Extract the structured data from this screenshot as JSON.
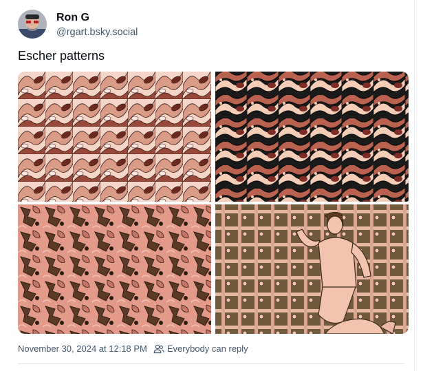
{
  "author": {
    "display_name": "Ron G",
    "handle": "@rgart.bsky.social"
  },
  "post": {
    "text": "Escher patterns",
    "timestamp": "November 30, 2024 at 12:18 PM",
    "reply_setting": "Everybody can reply",
    "reply_icon": "people-icon"
  },
  "images": [
    {
      "name": "pattern-pink-brown-swirl",
      "palette": [
        "#f3d6c8",
        "#d99a86",
        "#9a4a3c",
        "#6e2a22"
      ]
    },
    {
      "name": "pattern-stripes-black",
      "palette": [
        "#f4cdb7",
        "#b9624f",
        "#7c2c25",
        "#1a1a1a"
      ]
    },
    {
      "name": "pattern-brown-pink-tiles",
      "palette": [
        "#e39a8a",
        "#c9746a",
        "#5a3a26",
        "#2c1c12"
      ]
    },
    {
      "name": "pattern-figure-on-grid",
      "palette": [
        "#6f5a3e",
        "#e9b8a4",
        "#f2c4b0",
        "#3c2a1a"
      ]
    }
  ]
}
